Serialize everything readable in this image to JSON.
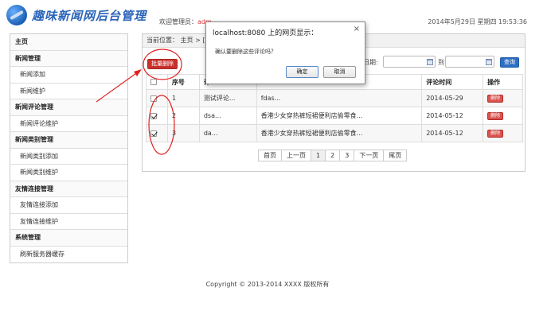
{
  "header": {
    "logo_text": "趣味新闻网后台管理",
    "welcome_prefix": "欢迎管理员：",
    "username": "adm",
    "datetime": "2014年5月29日 星期四 19:53:36"
  },
  "sidebar": {
    "sections": [
      {
        "title": "主页",
        "items": []
      },
      {
        "title": "新闻管理",
        "items": [
          "新闻添加",
          "新闻维护"
        ]
      },
      {
        "title": "新闻评论管理",
        "items": [
          "新闻评论维护"
        ]
      },
      {
        "title": "新闻类别管理",
        "items": [
          "新闻类别添加",
          "新闻类别维护"
        ]
      },
      {
        "title": "友情连接管理",
        "items": [
          "友情连接添加",
          "友情连接维护"
        ]
      },
      {
        "title": "系统管理",
        "items": [
          "刷新服务器缓存"
        ]
      }
    ]
  },
  "main": {
    "breadcrumb": "当前位置： 主页 > [",
    "batch_delete_label": "批量删除",
    "date_label": "日期:",
    "to_label": "到",
    "query_label": "查询",
    "table": {
      "headers": [
        "",
        "序号",
        "评",
        "",
        "评论时间",
        "操作"
      ],
      "rows": [
        {
          "checked": false,
          "no": "1",
          "comment": "测试评论...",
          "news": "fdas...",
          "time": "2014-05-29",
          "action": "删除"
        },
        {
          "checked": true,
          "no": "2",
          "comment": "dsa...",
          "news": "香港少女穿热裤短裙便利店偷零食...",
          "time": "2014-05-12",
          "action": "删除"
        },
        {
          "checked": true,
          "no": "3",
          "comment": "da...",
          "news": "香港少女穿热裤短裙便利店偷零食...",
          "time": "2014-05-12",
          "action": "删除"
        }
      ]
    },
    "pager": [
      "首页",
      "上一页",
      "1",
      "2",
      "3",
      "下一页",
      "尾页"
    ]
  },
  "dialog": {
    "title": "localhost:8080 上的网页显示：",
    "close": "×",
    "message": "确认要删除这些评论吗？",
    "ok_label": "确定",
    "cancel_label": "取消"
  },
  "footer": {
    "text": "Copyright © 2013-2014 XXXX 版权所有"
  },
  "colors": {
    "annotation": "#e02020",
    "accent_blue": "#2d6fc4",
    "danger_red": "#c9302c"
  }
}
